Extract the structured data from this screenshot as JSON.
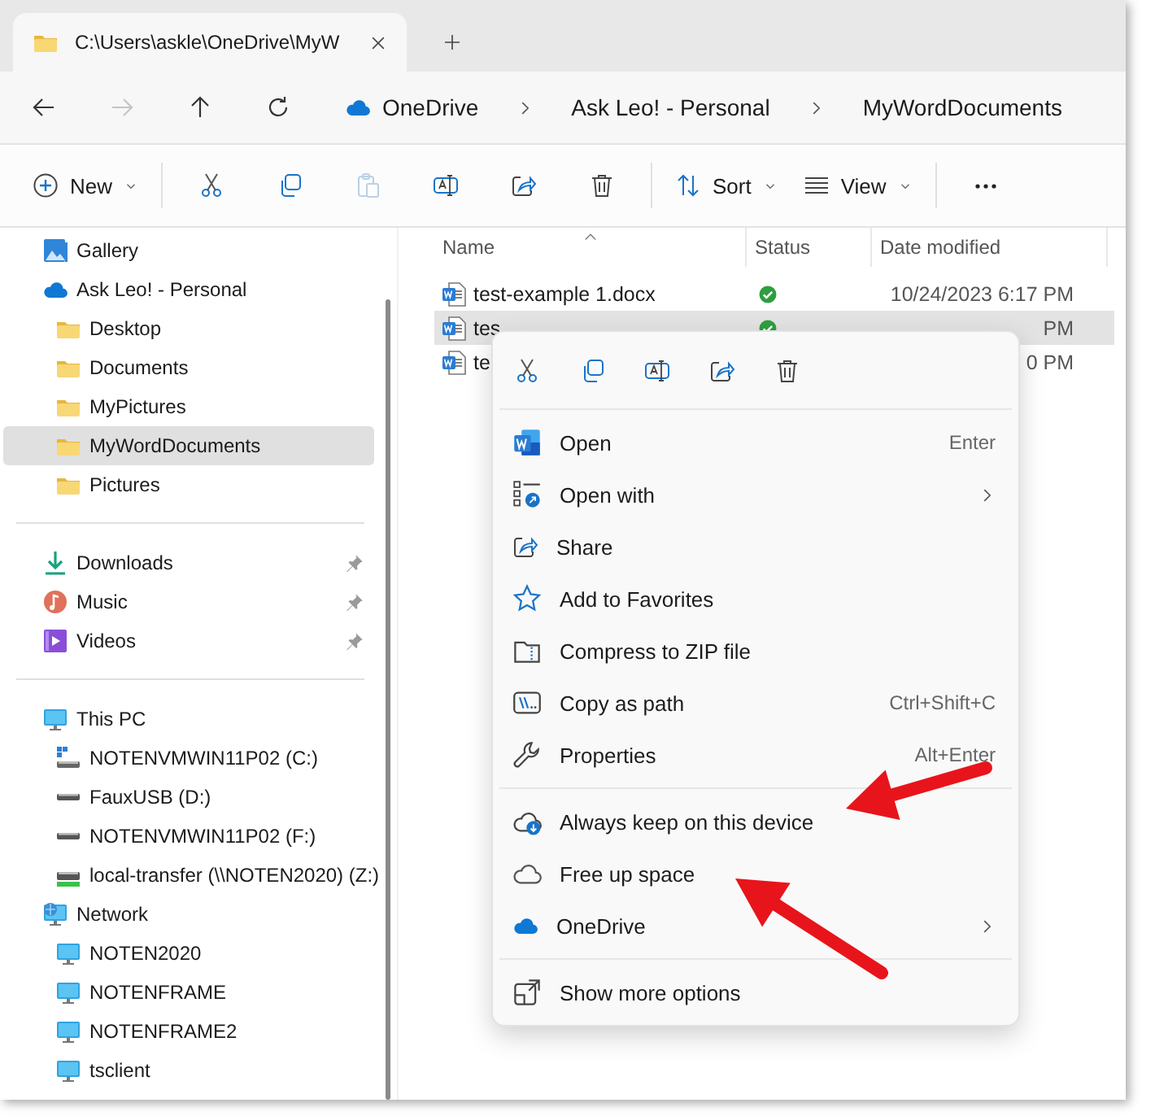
{
  "tab": {
    "title": "C:\\Users\\askle\\OneDrive\\MyW"
  },
  "navigation": [
    {
      "kind": "back",
      "disabled": false
    },
    {
      "kind": "forward",
      "disabled": true
    },
    {
      "kind": "up",
      "disabled": false
    },
    {
      "kind": "refresh",
      "disabled": false
    }
  ],
  "breadcrumb": [
    "OneDrive",
    "Ask Leo! - Personal",
    "MyWordDocuments"
  ],
  "toolbar": [
    {
      "kind": "new",
      "label": "New",
      "dropdown": true,
      "disabled": false
    },
    {
      "kind": "cut",
      "disabled": false
    },
    {
      "kind": "copy",
      "disabled": false
    },
    {
      "kind": "paste",
      "disabled": true
    },
    {
      "kind": "rename",
      "disabled": false
    },
    {
      "kind": "share",
      "disabled": false
    },
    {
      "kind": "delete",
      "disabled": false
    },
    {
      "kind": "sort",
      "label": "Sort",
      "dropdown": true,
      "disabled": false
    },
    {
      "kind": "view",
      "label": "View",
      "dropdown": true,
      "disabled": false
    },
    {
      "kind": "more",
      "disabled": false
    }
  ],
  "sidebar": {
    "sections": [
      [
        {
          "label": "Gallery",
          "kind": "gallery",
          "selected": false
        },
        {
          "label": "Ask Leo! - Personal",
          "kind": "onedrive",
          "selected": false,
          "children": [
            {
              "label": "Desktop",
              "kind": "folder",
              "selected": false
            },
            {
              "label": "Documents",
              "kind": "folder",
              "selected": false
            },
            {
              "label": "MyPictures",
              "kind": "folder",
              "selected": false
            },
            {
              "label": "MyWordDocuments",
              "kind": "folder",
              "selected": true
            },
            {
              "label": "Pictures",
              "kind": "folder",
              "selected": false
            }
          ]
        }
      ],
      [
        {
          "label": "Downloads",
          "kind": "downloads",
          "selected": false,
          "pinned": true
        },
        {
          "label": "Music",
          "kind": "music",
          "selected": false,
          "pinned": true
        },
        {
          "label": "Videos",
          "kind": "videos",
          "selected": false,
          "pinned": true
        }
      ],
      [
        {
          "label": "This PC",
          "kind": "pc",
          "selected": false,
          "children": [
            {
              "label": "NOTENVMWIN11P02 (C:)",
              "kind": "system-drive",
              "selected": false
            },
            {
              "label": "FauxUSB (D:)",
              "kind": "drive",
              "selected": false
            },
            {
              "label": "NOTENVMWIN11P02 (F:)",
              "kind": "drive",
              "selected": false
            },
            {
              "label": "local-transfer (\\\\NOTEN2020) (Z:)",
              "kind": "network-drive",
              "selected": false
            }
          ]
        },
        {
          "label": "Network",
          "kind": "network",
          "selected": false,
          "children": [
            {
              "label": "NOTEN2020",
              "kind": "computer",
              "selected": false
            },
            {
              "label": "NOTENFRAME",
              "kind": "computer",
              "selected": false
            },
            {
              "label": "NOTENFRAME2",
              "kind": "computer",
              "selected": false
            },
            {
              "label": "tsclient",
              "kind": "computer",
              "selected": false
            }
          ]
        }
      ]
    ]
  },
  "file_list": {
    "columns": [
      {
        "label": "Name",
        "sorted": true
      },
      {
        "label": "Status",
        "sorted": false
      },
      {
        "label": "Date modified",
        "sorted": false
      }
    ],
    "rows": [
      {
        "name": "test-example 1.docx",
        "synced": true,
        "date": "10/24/2023 6:17 PM",
        "selected": false
      },
      {
        "name": "tes",
        "synced": true,
        "date": "PM",
        "selected": true
      },
      {
        "name": "te",
        "date": "0 PM",
        "selected": false
      }
    ]
  },
  "context_menu": {
    "actions": [
      {
        "kind": "cut"
      },
      {
        "kind": "copy"
      },
      {
        "kind": "rename"
      },
      {
        "kind": "share"
      },
      {
        "kind": "delete"
      }
    ],
    "groups": [
      [
        {
          "kind": "word",
          "label": "Open",
          "shortcut": "Enter",
          "submenu": false
        },
        {
          "kind": "open-with",
          "label": "Open with",
          "submenu": true
        },
        {
          "kind": "share",
          "label": "Share",
          "submenu": false
        },
        {
          "kind": "star",
          "label": "Add to Favorites",
          "submenu": false
        },
        {
          "kind": "zip",
          "label": "Compress to ZIP file",
          "submenu": false
        },
        {
          "kind": "path",
          "label": "Copy as path",
          "shortcut": "Ctrl+Shift+C",
          "submenu": false
        },
        {
          "kind": "wrench",
          "label": "Properties",
          "shortcut": "Alt+Enter",
          "submenu": false
        }
      ],
      [
        {
          "kind": "cloud-keep",
          "label": "Always keep on this device",
          "submenu": false
        },
        {
          "kind": "cloud",
          "label": "Free up space",
          "submenu": false
        },
        {
          "kind": "onedrive",
          "label": "OneDrive",
          "submenu": true
        }
      ],
      [
        {
          "kind": "more-options",
          "label": "Show more options",
          "submenu": false
        }
      ]
    ]
  },
  "annotations": [
    {
      "kind": "arrow",
      "color": "#e8141b"
    },
    {
      "kind": "arrow",
      "color": "#e8141b"
    }
  ]
}
